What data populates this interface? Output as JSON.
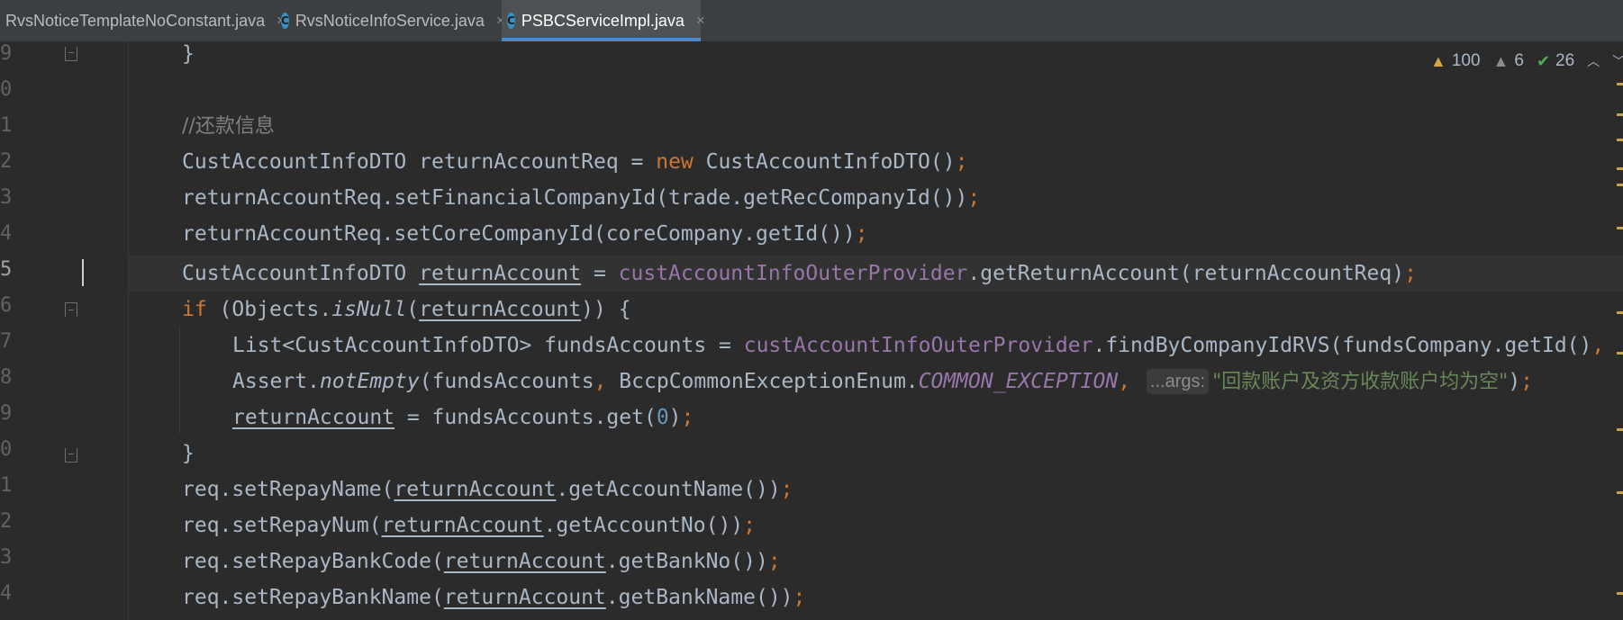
{
  "tabs": [
    {
      "label": "RvsNoticeTemplateNoConstant.java",
      "icon": "",
      "active": false
    },
    {
      "label": "RvsNoticeInfoService.java",
      "icon": "C",
      "active": false
    },
    {
      "label": "PSBCServiceImpl.java",
      "icon": "C",
      "active": true
    }
  ],
  "tab_close_glyph": "×",
  "inspections": {
    "warnings": "100",
    "weak_warnings": "6",
    "typos": "26"
  },
  "line_numbers": [
    "9",
    "0",
    "1",
    "2",
    "3",
    "4",
    "5",
    "6",
    "7",
    "8",
    "9",
    "0",
    "1",
    "2",
    "3",
    "4"
  ],
  "current_line_index": 6,
  "code": {
    "l0_brace": "}",
    "l2_comment": "//还款信息",
    "l3": {
      "type": "CustAccountInfoDTO",
      "var": "returnAccountReq",
      "eq": " = ",
      "kw": "new",
      "ctor": " CustAccountInfoDTO()",
      "semi": ";"
    },
    "l4": {
      "text": "returnAccountReq.setFinancialCompanyId(trade.getRecCompanyId())",
      "semi": ";"
    },
    "l5": {
      "text": "returnAccountReq.setCoreCompanyId(coreCompany.getId())",
      "semi": ";"
    },
    "l6": {
      "type": "CustAccountInfoDTO ",
      "var": "returnAccount",
      "eq": " = ",
      "field": "custAccountInfoOuterProvider",
      "call": ".getReturnAccount(returnAccountReq)",
      "semi": ";"
    },
    "l7": {
      "kw": "if",
      "pre": " (Objects.",
      "method": "isNull",
      "open": "(",
      "var": "returnAccount",
      "post": ")) {"
    },
    "l8": {
      "pre": "List<CustAccountInfoDTO> fundsAccounts = ",
      "field": "custAccountInfoOuterProvider",
      "call": ".findByCompanyIdRVS(fundsCompany.getId()",
      "comma": ","
    },
    "l9": {
      "pre": "Assert.",
      "method": "notEmpty",
      "args": "(fundsAccounts",
      "comma1": ",",
      "cls": " BccpCommonExceptionEnum.",
      "constant": "COMMON_EXCEPTION",
      "comma2": ",",
      "hint": "...args:",
      "str": "\"回款账户及资方收款账户均为空\"",
      "close": ")",
      "semi": ";"
    },
    "l10": {
      "var": "returnAccount",
      "mid": " = fundsAccounts.get(",
      "num": "0",
      "close": ")",
      "semi": ";"
    },
    "l11_brace": "}",
    "l12": {
      "pre": "req.setRepayName(",
      "var": "returnAccount",
      "post": ".getAccountName())",
      "semi": ";"
    },
    "l13": {
      "pre": "req.setRepayNum(",
      "var": "returnAccount",
      "post": ".getAccountNo())",
      "semi": ";"
    },
    "l14": {
      "pre": "req.setRepayBankCode(",
      "var": "returnAccount",
      "post": ".getBankNo())",
      "semi": ";"
    },
    "l15": {
      "pre": "req.setRepayBankName(",
      "var": "returnAccount",
      "post": ".getBankName())",
      "semi": ";"
    }
  },
  "colors": {
    "background": "#2b2b2b",
    "keyword": "#cc7832",
    "field": "#9876aa",
    "string": "#6a8759",
    "number": "#6897bb",
    "comment": "#808080",
    "plain": "#a9b7c6",
    "active_tab_underline": "#4a88c7"
  }
}
